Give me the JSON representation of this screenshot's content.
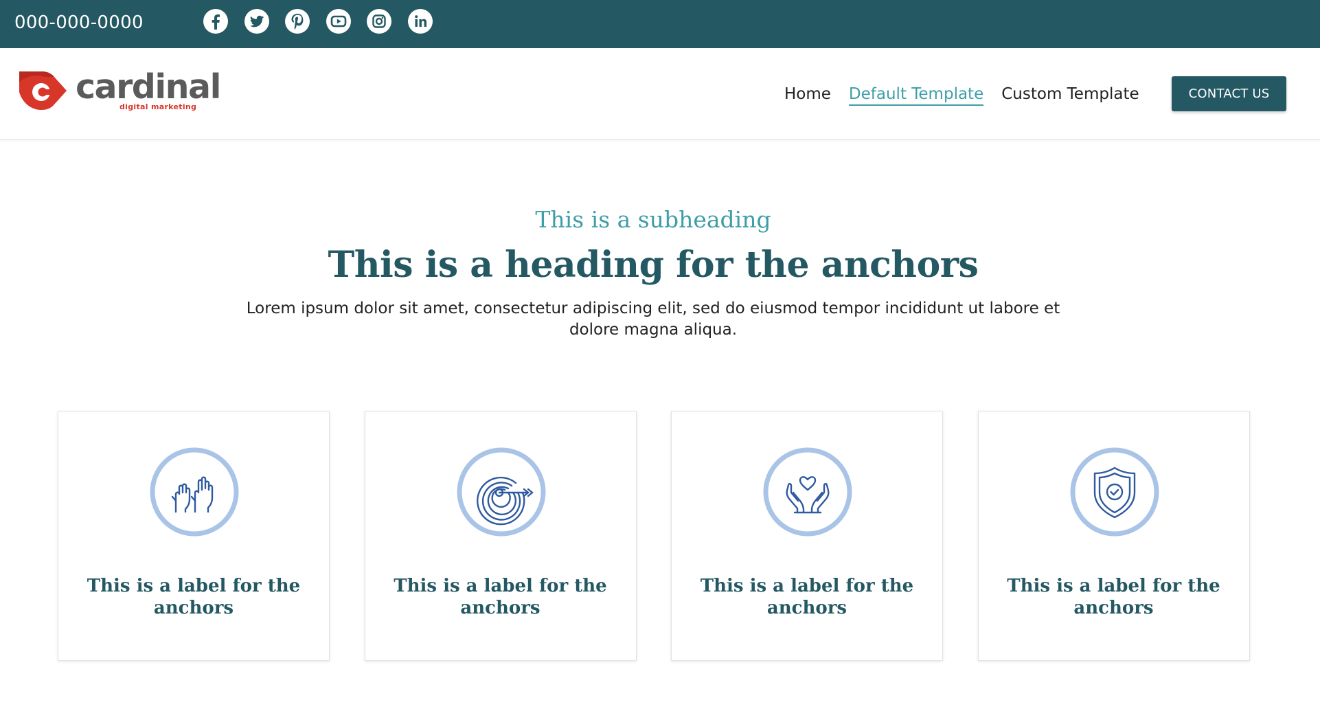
{
  "topbar": {
    "phone": "000-000-0000",
    "background": "#245863",
    "social_icons": [
      "facebook-icon",
      "twitter-icon",
      "pinterest-icon",
      "youtube-icon",
      "instagram-icon",
      "linkedin-icon"
    ]
  },
  "logo": {
    "wordmark": "cardinal",
    "tagline": "digital marketing",
    "mark_color": "#d9362a"
  },
  "nav": {
    "items": [
      {
        "label": "Home"
      },
      {
        "label": "Default Template",
        "active": true
      },
      {
        "label": "Custom Template"
      }
    ],
    "contact_label": "CONTACT US",
    "active_color": "#3d9ea8"
  },
  "intro": {
    "subheading": "This is a subheading",
    "heading": "This is a heading for the anchors",
    "body": "Lorem ipsum dolor sit amet, consectetur adipiscing elit, sed do eiusmod tempor incididunt ut labore et dolore magna aliqua."
  },
  "cards": [
    {
      "icon": "raised-hands-icon",
      "label": "This is a label for the anchors"
    },
    {
      "icon": "target-icon",
      "label": "This is a label for the anchors"
    },
    {
      "icon": "hands-heart-icon",
      "label": "This is a label for the anchors"
    },
    {
      "icon": "shield-check-icon",
      "label": "This is a label for the anchors"
    }
  ],
  "colors": {
    "primary": "#245863",
    "accent": "#3d9ea8",
    "icon_ring": "#a9c4e6",
    "icon_line": "#2f5a9e"
  }
}
